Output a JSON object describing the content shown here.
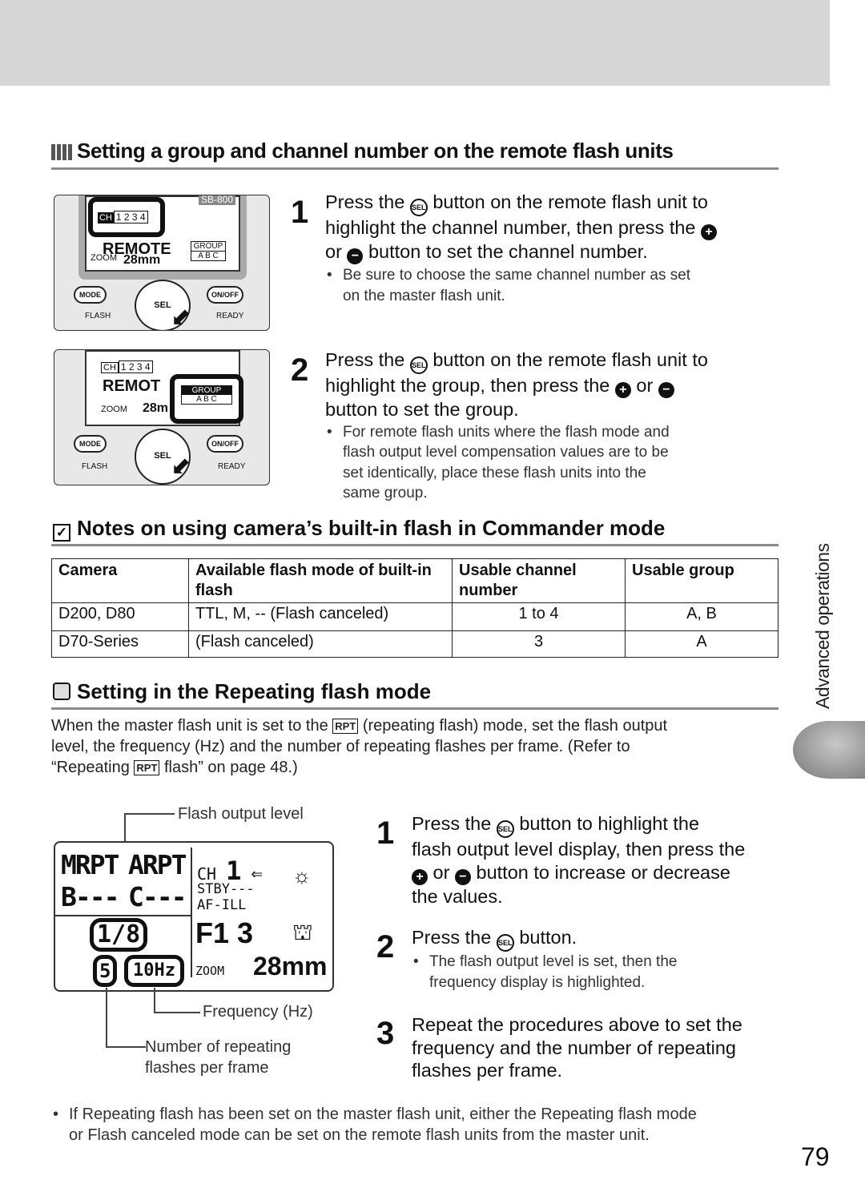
{
  "section1": {
    "title": "Setting a group and channel number on the remote flash units",
    "steps": [
      {
        "num": "1",
        "line1a": "Press the",
        "line1b": "button on the remote flash unit to",
        "line2": "highlight the channel number, then press the",
        "line3a": "or",
        "line3b": "button to set the channel number.",
        "note1": "Be sure to choose the same channel number as set",
        "note2": "on the master flash unit."
      },
      {
        "num": "2",
        "line1a": "Press the",
        "line1b": "button on the remote flash unit to",
        "line2a": "highlight the group, then press the",
        "line2b": "or",
        "line3": "button to set the group.",
        "note1": "For remote flash units where the flash mode and",
        "note2": "flash output level compensation values are to be",
        "note3": "set identically, place these flash units into the",
        "note4": "same group."
      }
    ],
    "illustration1": {
      "model": "SB-800",
      "ch": "CH",
      "channels": "1 2 3 4",
      "mode": "REMOTE",
      "group_label": "GROUP",
      "groups": "A B C",
      "zoom": "ZOOM",
      "zoom_mode": "M",
      "focal": "28mm",
      "mode_btn": "MODE",
      "onoff_btn": "ON/OFF",
      "flash_label": "FLASH",
      "ready_label": "READY",
      "sel": "SEL"
    },
    "illustration2": {
      "ch": "CH",
      "channels": "1 2 3 4",
      "mode": "REMOT",
      "group_label": "GROUP",
      "groups": "A B C",
      "zoom": "ZOOM",
      "zoom_mode": "M",
      "focal": "28m",
      "mode_btn": "MODE",
      "onoff_btn": "ON/OFF",
      "flash_label": "FLASH",
      "ready_label": "READY",
      "sel": "SEL"
    }
  },
  "section2": {
    "title": "Notes on using camera’s built-in flash in Commander mode",
    "table": {
      "headers": [
        "Camera",
        "Available flash mode of built-in flash",
        "Usable channel number",
        "Usable group"
      ],
      "rows": [
        [
          "D200, D80",
          "TTL, M, -- (Flash canceled)",
          "1 to 4",
          "A, B"
        ],
        [
          "D70-Series",
          "(Flash canceled)",
          "3",
          "A"
        ]
      ]
    }
  },
  "section3": {
    "title": "Setting in the Repeating flash mode",
    "para1": "When the master flash unit is set to the",
    "rpt": "RPT",
    "para2": "(repeating flash) mode, set the flash output",
    "para3": "level, the frequency (Hz) and the number of repeating flashes per frame. (Refer to",
    "para4": "“Repeating",
    "para5": "flash” on page 48.)",
    "callouts": {
      "output": "Flash output level",
      "freq": "Frequency (Hz)",
      "num1": "Number of repeating",
      "num2": "flashes per frame"
    },
    "lcd": {
      "mrpt": "MRPT",
      "arpt": "ARPT",
      "b": "B---",
      "c": "C---",
      "ch": "CH",
      "chnum": "1",
      "stby": "STBY---",
      "afill": "AF-ILL",
      "level": "1/8",
      "fnum": "F1 3",
      "count": "5",
      "hz": "10Hz",
      "zoom": "ZOOM",
      "focal": "28mm"
    },
    "steps": [
      {
        "num": "1",
        "l1a": "Press the",
        "l1b": "button to highlight the",
        "l2": "flash output level display, then press the",
        "l3a": "or",
        "l3b": "button to increase or decrease",
        "l4": "the values."
      },
      {
        "num": "2",
        "l1a": "Press the",
        "l1b": "button.",
        "note1": "The flash output level is set, then the",
        "note2": "frequency display is highlighted."
      },
      {
        "num": "3",
        "l1": "Repeat the procedures above to set the",
        "l2": "frequency and the number of repeating",
        "l3": "flashes per frame."
      }
    ]
  },
  "footnote1": "If Repeating flash has been set on the master flash unit, either the Repeating flash mode",
  "footnote2": "or Flash canceled mode can be set on the remote flash units from the master unit.",
  "side_tab": "Advanced operations",
  "page_number": "79",
  "icons": {
    "sel": "SEL",
    "plus": "+",
    "minus": "−"
  }
}
